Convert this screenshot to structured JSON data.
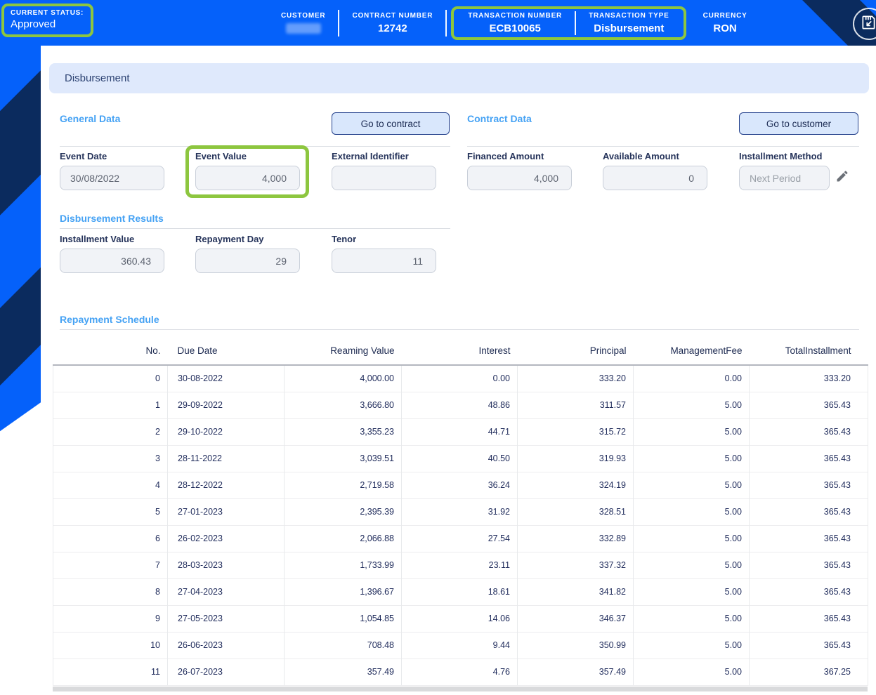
{
  "header": {
    "status": {
      "label": "CURRENT STATUS:",
      "value": "Approved"
    },
    "fields": [
      {
        "label": "CUSTOMER",
        "value": "",
        "redacted": true
      },
      {
        "label": "CONTRACT NUMBER",
        "value": "12742"
      },
      {
        "label": "TRANSACTION NUMBER",
        "value": "ECB10065",
        "highlighted": true
      },
      {
        "label": "TRANSACTION TYPE",
        "value": "Disbursement",
        "highlighted": true
      },
      {
        "label": "CURRENCY",
        "value": "RON"
      }
    ]
  },
  "page": {
    "panel_title": "Disbursement"
  },
  "general_data": {
    "heading": "General Data",
    "button_label": "Go to contract",
    "fields": [
      {
        "label": "Event Date",
        "value": "30/08/2022"
      },
      {
        "label": "Event Value",
        "value": "4,000",
        "highlighted": true
      },
      {
        "label": "External Identifier",
        "value": ""
      }
    ]
  },
  "contract_data": {
    "heading": "Contract Data",
    "button_label": "Go to customer",
    "fields": [
      {
        "label": "Financed Amount",
        "value": "4,000"
      },
      {
        "label": "Available Amount",
        "value": "0"
      },
      {
        "label": "Installment Method",
        "value": "Next Period",
        "editable_icon": "pencil-icon"
      }
    ]
  },
  "disbursement_results": {
    "heading": "Disbursement Results",
    "fields": [
      {
        "label": "Installment Value",
        "value": "360.43"
      },
      {
        "label": "Repayment Day",
        "value": "29"
      },
      {
        "label": "Tenor",
        "value": "11"
      }
    ]
  },
  "repayment_schedule": {
    "heading": "Repayment Schedule",
    "columns": [
      "No.",
      "Due Date",
      "Reaming Value",
      "Interest",
      "Principal",
      "ManagementFee",
      "TotalInstallment"
    ],
    "rows": [
      [
        "0",
        "30-08-2022",
        "4,000.00",
        "0.00",
        "333.20",
        "0.00",
        "333.20"
      ],
      [
        "1",
        "29-09-2022",
        "3,666.80",
        "48.86",
        "311.57",
        "5.00",
        "365.43"
      ],
      [
        "2",
        "29-10-2022",
        "3,355.23",
        "44.71",
        "315.72",
        "5.00",
        "365.43"
      ],
      [
        "3",
        "28-11-2022",
        "3,039.51",
        "40.50",
        "319.93",
        "5.00",
        "365.43"
      ],
      [
        "4",
        "28-12-2022",
        "2,719.58",
        "36.24",
        "324.19",
        "5.00",
        "365.43"
      ],
      [
        "5",
        "27-01-2023",
        "2,395.39",
        "31.92",
        "328.51",
        "5.00",
        "365.43"
      ],
      [
        "6",
        "26-02-2023",
        "2,066.88",
        "27.54",
        "332.89",
        "5.00",
        "365.43"
      ],
      [
        "7",
        "28-03-2023",
        "1,733.99",
        "23.11",
        "337.32",
        "5.00",
        "365.43"
      ],
      [
        "8",
        "27-04-2023",
        "1,396.67",
        "18.61",
        "341.82",
        "5.00",
        "365.43"
      ],
      [
        "9",
        "27-05-2023",
        "1,054.85",
        "14.06",
        "346.37",
        "5.00",
        "365.43"
      ],
      [
        "10",
        "26-06-2023",
        "708.48",
        "9.44",
        "350.99",
        "5.00",
        "365.43"
      ],
      [
        "11",
        "26-07-2023",
        "357.49",
        "4.76",
        "357.49",
        "5.00",
        "367.25"
      ]
    ]
  },
  "colors": {
    "accent_blue": "#0561fa",
    "navy_stripe": "#0b2b5e",
    "highlight_green": "#8dc63f",
    "section_heading_blue": "#45a2f4",
    "panel_banner_bg": "#dfe9fc"
  }
}
